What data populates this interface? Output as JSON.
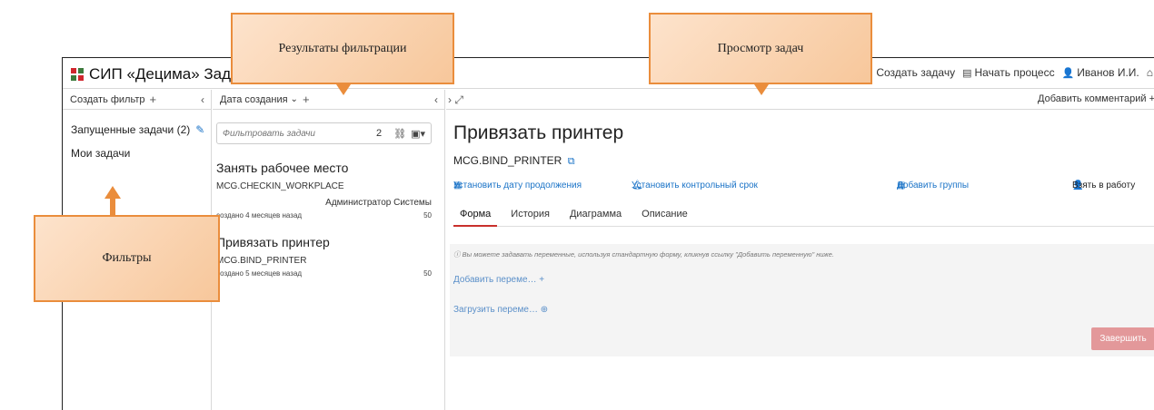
{
  "app": {
    "title": "СИП «Децима» Задачи"
  },
  "navbar": {
    "truncated": "ш",
    "create_task": "Создать задачу",
    "start_process": "Начать процесс",
    "user": "Иванов И.И."
  },
  "filters": {
    "create_label": "Создать фильтр",
    "items": [
      {
        "label": "Запущенные задачи (2)"
      },
      {
        "label": "Мои задачи"
      }
    ]
  },
  "list": {
    "sort_label": "Дата создания",
    "search_placeholder": "Фильтровать задачи",
    "count": "2",
    "tasks": [
      {
        "name": "Занять рабочее место",
        "key": "MCG.CHECKIN_WORKPLACE",
        "assignee": "Администратор Системы",
        "created": "создано 4 месяцев назад",
        "priority": "50"
      },
      {
        "name": "Привязать принтер",
        "key": "MCG.BIND_PRINTER",
        "assignee": "",
        "created": "создано 5 месяцев назад",
        "priority": "50"
      }
    ]
  },
  "detail": {
    "add_comment": "Добавить комментарий",
    "title": "Привязать принтер",
    "key": "MCG.BIND_PRINTER",
    "actions": {
      "follow_up": "Установить дату продолжения",
      "due": "Установить контрольный срок",
      "groups": "Добавить группы",
      "claim": "Взять в работу"
    },
    "tabs": [
      "Форма",
      "История",
      "Диаграмма",
      "Описание"
    ],
    "hint": "Вы можете задавать переменные, используя стандартную форму, кликнув ссылку \"Добавить переменную\" ниже.",
    "add_variable": "Добавить переме…",
    "load_variable": "Загрузить переме…",
    "finish": "Завершить"
  },
  "callouts": {
    "results": "Результаты фильтрации",
    "view": "Просмотр задач",
    "filters": "Фильтры"
  },
  "colors": {
    "accent_link": "#1a73c7",
    "callout_border": "#ea8d3c",
    "finish_button": "#e3989a",
    "active_tab": "#c9302c"
  }
}
